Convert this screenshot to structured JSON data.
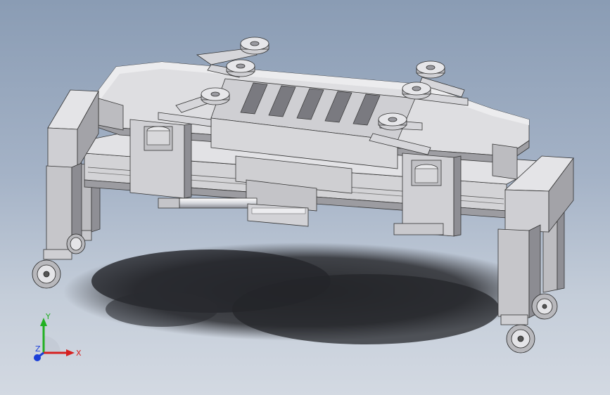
{
  "viewport": {
    "model_name": "",
    "background_top": "#8a9cb4",
    "background_bottom": "#d3d9e2"
  },
  "model": {
    "part_color": "#d9d9dc",
    "shade_color": "#a9a9ad",
    "dark_color": "#6e6e74",
    "shadow_color": "#2e2f33",
    "wheels": 4,
    "roller_pads": 6
  },
  "triad": {
    "x_label": "X",
    "y_label": "Y",
    "z_label": "Z",
    "x_color": "#d62020",
    "y_color": "#22b022",
    "z_color": "#1b3fd8"
  }
}
